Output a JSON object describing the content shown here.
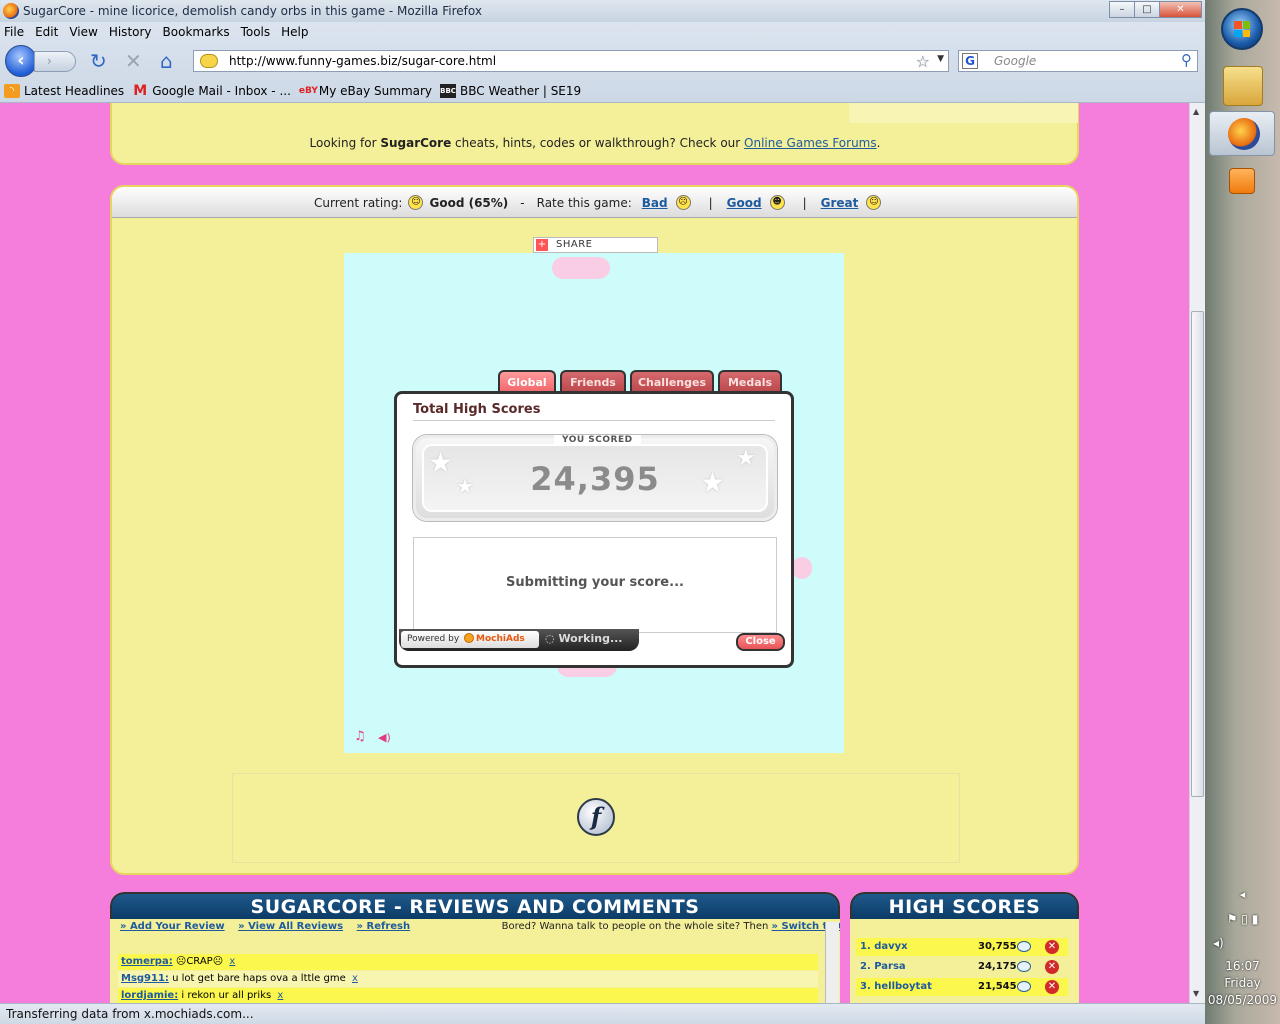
{
  "window": {
    "title": "SugarCore - mine licorice, demolish candy orbs in this game - Mozilla Firefox",
    "buttons": {
      "minimize": "–",
      "maximize": "□",
      "close": "✕"
    }
  },
  "menu": [
    "File",
    "Edit",
    "View",
    "History",
    "Bookmarks",
    "Tools",
    "Help"
  ],
  "nav": {
    "back_glyph": "‹",
    "forward_glyph": "›",
    "reload_glyph": "↻",
    "stop_glyph": "✕",
    "home_glyph": "⌂",
    "url": "http://www.funny-games.biz/sugar-core.html",
    "search_placeholder": "Google"
  },
  "bookmarks": [
    {
      "label": "Latest Headlines",
      "icon": "rss-icon",
      "glyph": "◝"
    },
    {
      "label": "Google Mail - Inbox - ...",
      "icon": "gmail-icon",
      "glyph": "M"
    },
    {
      "label": "My eBay Summary",
      "icon": "ebay-icon",
      "glyph": "eBY"
    },
    {
      "label": "BBC Weather | SE19",
      "icon": "bbc-icon",
      "glyph": "BBC"
    }
  ],
  "page": {
    "forums": {
      "prefix": "Looking for ",
      "game": "SugarCore",
      "middle": " cheats, hints, codes or walkthrough? Check our ",
      "link": "Online Games Forums",
      "suffix": "."
    },
    "rating": {
      "current_label": "Current rating:",
      "current_value": "Good (65%)",
      "dash": "-",
      "rate_label": "Rate this game:",
      "bad": "Bad",
      "good": "Good",
      "great": "Great",
      "sep": "|"
    },
    "share_label": "SHARE",
    "widget": {
      "tabs": [
        "Global",
        "Friends",
        "Challenges",
        "Medals"
      ],
      "active_tab": "Global",
      "title": "Total High Scores",
      "you_scored": "YOU SCORED",
      "score": "24,395",
      "status": "Submitting your score...",
      "powered_by": "Powered by",
      "mochi": "MochiAds",
      "working": "Working...",
      "close": "Close"
    },
    "flash_glyph": "f"
  },
  "reviews": {
    "title": "SUGARCORE - REVIEWS AND COMMENTS",
    "links": [
      "» Add Your Review",
      "» View All Reviews",
      "» Refresh"
    ],
    "chat_prefix": "Bored? Wanna talk to people on the whole site? Then ",
    "chat_link": "» Switch to Chat Box",
    "chat_suffix": ".",
    "comments": [
      {
        "user": "tomerpa:",
        "text": "☹CRAP☹",
        "x": "x"
      },
      {
        "user": "Msg911:",
        "text": "u lot get bare haps ova a lttle gme",
        "x": "x"
      },
      {
        "user": "lordjamie:",
        "text": "i rekon ur all priks",
        "x": "x"
      }
    ]
  },
  "high_scores": {
    "title": "HIGH SCORES",
    "rows": [
      {
        "name": "1. davyx",
        "score": "30,755"
      },
      {
        "name": "2. Parsa",
        "score": "24,175"
      },
      {
        "name": "3. hellboytat",
        "score": "21,545"
      }
    ]
  },
  "status_bar": "Transferring data from x.mochiads.com...",
  "taskbar": {
    "time": "16:07",
    "day": "Friday",
    "date": "08/05/2009"
  }
}
